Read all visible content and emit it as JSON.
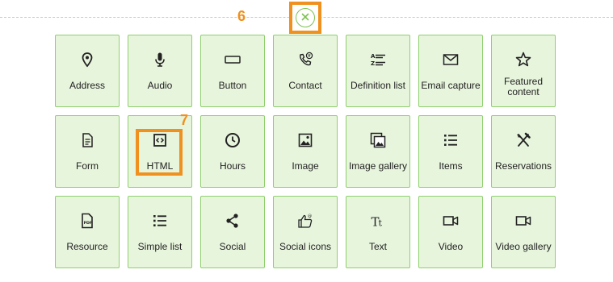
{
  "annotations": {
    "callout_close": "6",
    "callout_html": "7"
  },
  "colors": {
    "tile_bg": "#e8f5dd",
    "tile_border": "#8fcf6e",
    "highlight": "#f0901e",
    "close_accent": "#7cc24f"
  },
  "close_icon": "close-icon",
  "tiles": [
    {
      "label": "Address",
      "icon": "location-pin-icon"
    },
    {
      "label": "Audio",
      "icon": "microphone-icon"
    },
    {
      "label": "Button",
      "icon": "button-icon"
    },
    {
      "label": "Contact",
      "icon": "contact-phone-icon"
    },
    {
      "label": "Definition list",
      "icon": "definition-list-icon"
    },
    {
      "label": "Email capture",
      "icon": "envelope-icon"
    },
    {
      "label": "Featured content",
      "icon": "star-icon"
    },
    {
      "label": "Form",
      "icon": "form-icon"
    },
    {
      "label": "HTML",
      "icon": "code-icon"
    },
    {
      "label": "Hours",
      "icon": "clock-icon"
    },
    {
      "label": "Image",
      "icon": "image-icon"
    },
    {
      "label": "Image gallery",
      "icon": "image-gallery-icon"
    },
    {
      "label": "Items",
      "icon": "list-icon"
    },
    {
      "label": "Reservations",
      "icon": "fork-knife-icon"
    },
    {
      "label": "Resource",
      "icon": "pdf-file-icon"
    },
    {
      "label": "Simple list",
      "icon": "list-icon"
    },
    {
      "label": "Social",
      "icon": "share-icon"
    },
    {
      "label": "Social icons",
      "icon": "thumbs-up-icon"
    },
    {
      "label": "Text",
      "icon": "text-icon"
    },
    {
      "label": "Video",
      "icon": "video-camera-icon"
    },
    {
      "label": "Video gallery",
      "icon": "video-camera-icon"
    }
  ]
}
